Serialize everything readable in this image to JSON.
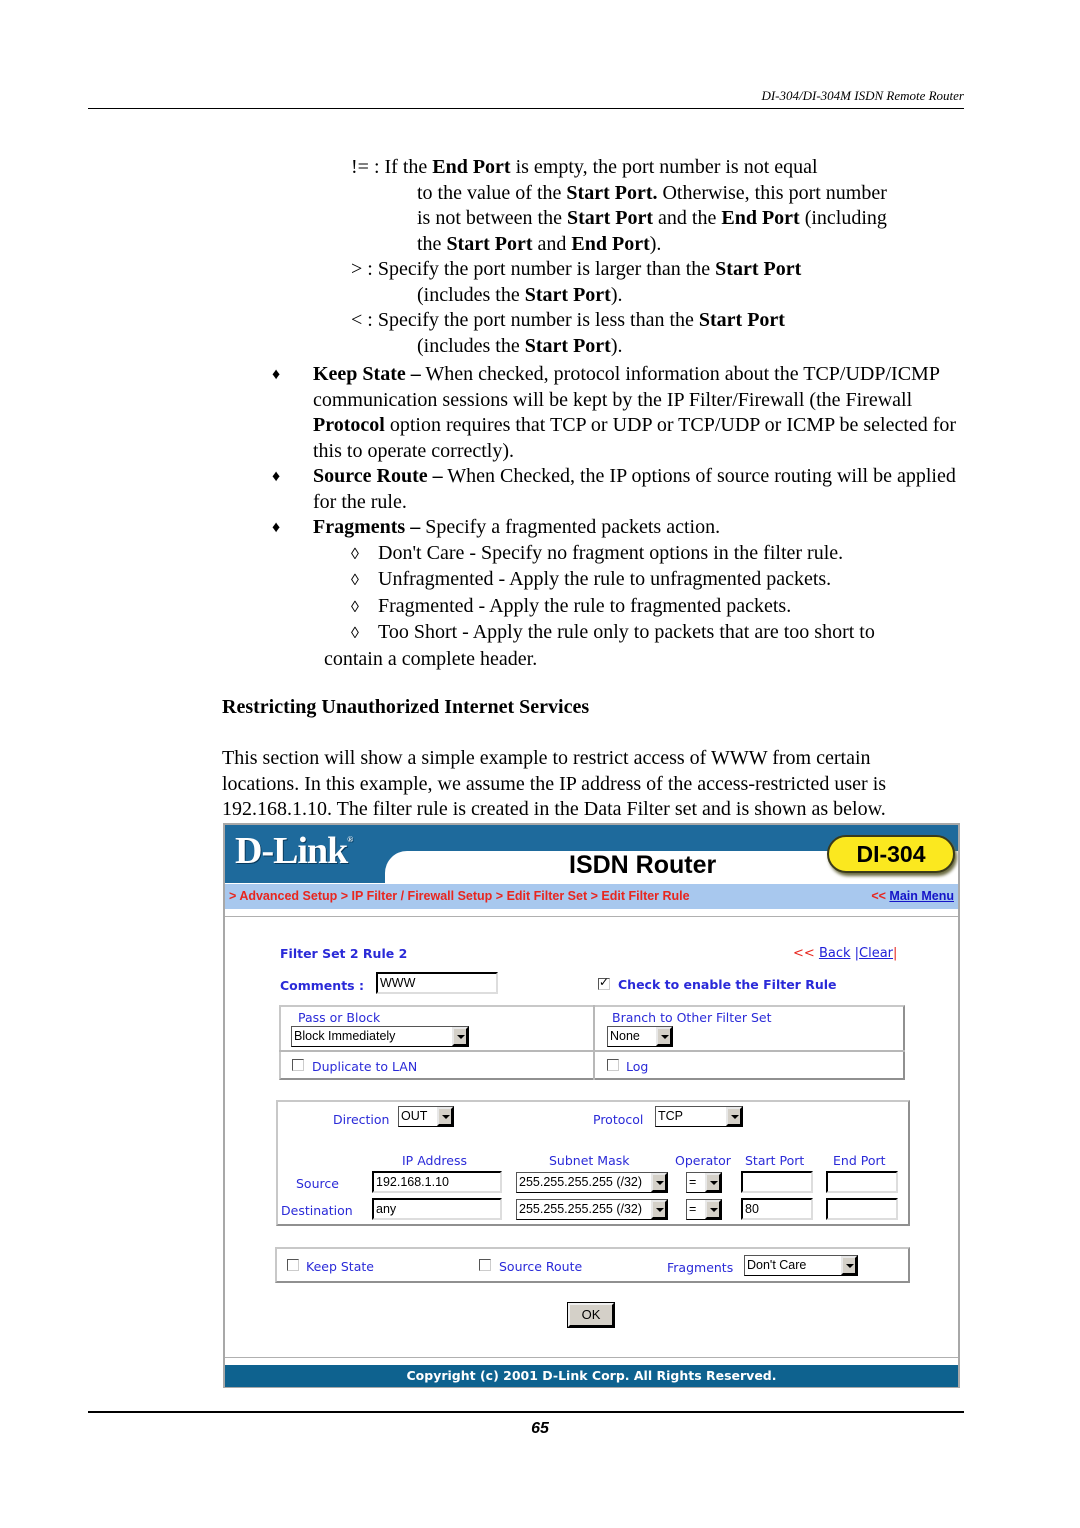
{
  "running_header": "DI-304/DI-304M ISDN Remote Router",
  "operators": [
    {
      "lines": [
        [
          {
            "t": "!= : If the "
          },
          {
            "t": "End Port",
            "b": true
          },
          {
            "t": " is empty, the port number is not equal"
          }
        ],
        [
          {
            "t": "to the value of the "
          },
          {
            "t": "Start Port.",
            "b": true
          },
          {
            "t": " Otherwise, this port number"
          }
        ],
        [
          {
            "t": "is not between the "
          },
          {
            "t": "Start Port",
            "b": true
          },
          {
            "t": " and the "
          },
          {
            "t": "End Port",
            "b": true
          },
          {
            "t": " (including"
          }
        ],
        [
          {
            "t": "the "
          },
          {
            "t": "Start Port",
            "b": true
          },
          {
            "t": " and "
          },
          {
            "t": "End Port",
            "b": true
          },
          {
            "t": ")."
          }
        ]
      ]
    },
    {
      "lines": [
        [
          {
            "t": "> : Specify the port number is larger than the "
          },
          {
            "t": "Start Port",
            "b": true
          }
        ],
        [
          {
            "t": "(includes the "
          },
          {
            "t": "Start Port",
            "b": true
          },
          {
            "t": ")."
          }
        ]
      ]
    },
    {
      "lines": [
        [
          {
            "t": "< : Specify the port number is less than the "
          },
          {
            "t": "Start Port",
            "b": true
          }
        ],
        [
          {
            "t": "(includes the "
          },
          {
            "t": "Start Port",
            "b": true
          },
          {
            "t": ")."
          }
        ]
      ]
    }
  ],
  "bullets": [
    {
      "marker": "♦",
      "term": "Keep State –",
      "text": " When checked, protocol information about the TCP/UDP/ICMP communication sessions will be kept by the IP Filter/Firewall (the Firewall ",
      "bold2": "Protocol",
      "text2": " option requires that TCP or UDP or TCP/UDP or ICMP be selected for this to operate correctly)."
    },
    {
      "marker": "♦",
      "term": "Source Route –",
      "text": " When Checked, the IP options of source routing will be applied for the rule."
    },
    {
      "marker": "♦",
      "term": "Fragments –",
      "text": " Specify a fragmented packets action."
    }
  ],
  "fragment_options": [
    {
      "marker": "◊",
      "text": "Don't Care - Specify no fragment options in the filter rule."
    },
    {
      "marker": "◊",
      "text": "Unfragmented - Apply the rule to unfragmented packets."
    },
    {
      "marker": "◊",
      "text": "Fragmented - Apply the rule to fragmented packets."
    },
    {
      "marker": "◊",
      "text": "Too Short - Apply the rule only to packets that are too short to",
      "cont": "contain a complete header."
    }
  ],
  "section_title": "Restricting Unauthorized Internet Services",
  "intro_lines": [
    "This section will show a simple example to restrict access of WWW from certain",
    "locations. In this example, we assume the IP address of the access-restricted user is",
    "192.168.1.10. The filter rule is created in the Data Filter set and is shown as below."
  ],
  "router_ui": {
    "logo": "D-Link",
    "logo_reg": "®",
    "app_title": "ISDN Router",
    "model": "DI-304",
    "breadcrumb": [
      "Advanced Setup",
      "IP Filter / Firewall Setup",
      "Edit Filter Set",
      "Edit Filter Rule"
    ],
    "breadcrumb_sep": "> ",
    "main_menu_arrow": "<<",
    "main_menu": "Main Menu",
    "rule_title": "Filter Set 2 Rule 2",
    "back_arrow": "<<",
    "back": "Back",
    "clear": "Clear",
    "pipe": "|",
    "comments_label": "Comments :",
    "comments_value": "WWW",
    "enable_label": "Check to enable the Filter Rule",
    "enable_checked": true,
    "pass_block_label": "Pass or Block",
    "pass_block_value": "Block Immediately",
    "branch_label": "Branch to Other Filter Set",
    "branch_value": "None",
    "duplicate_label": "Duplicate to LAN",
    "duplicate_checked": false,
    "log_label": "Log",
    "log_checked": false,
    "direction_label": "Direction",
    "direction_value": "OUT",
    "protocol_label": "Protocol",
    "protocol_value": "TCP",
    "col_ip": "IP Address",
    "col_mask": "Subnet Mask",
    "col_operator": "Operator",
    "col_start": "Start Port",
    "col_end": "End Port",
    "rows": [
      {
        "label": "Source",
        "ip": "192.168.1.10",
        "mask": "255.255.255.255 (/32)",
        "operator": "=",
        "start": "",
        "end": ""
      },
      {
        "label": "Destination",
        "ip": "any",
        "mask": "255.255.255.255 (/32)",
        "operator": "=",
        "start": "80",
        "end": ""
      }
    ],
    "keep_state_label": "Keep State",
    "keep_state_checked": false,
    "source_route_label": "Source Route",
    "source_route_checked": false,
    "fragments_label": "Fragments",
    "fragments_value": "Don't Care",
    "ok": "OK",
    "copyright": "Copyright (c) 2001 D-Link Corp. All Rights Reserved."
  },
  "page_number": "65"
}
